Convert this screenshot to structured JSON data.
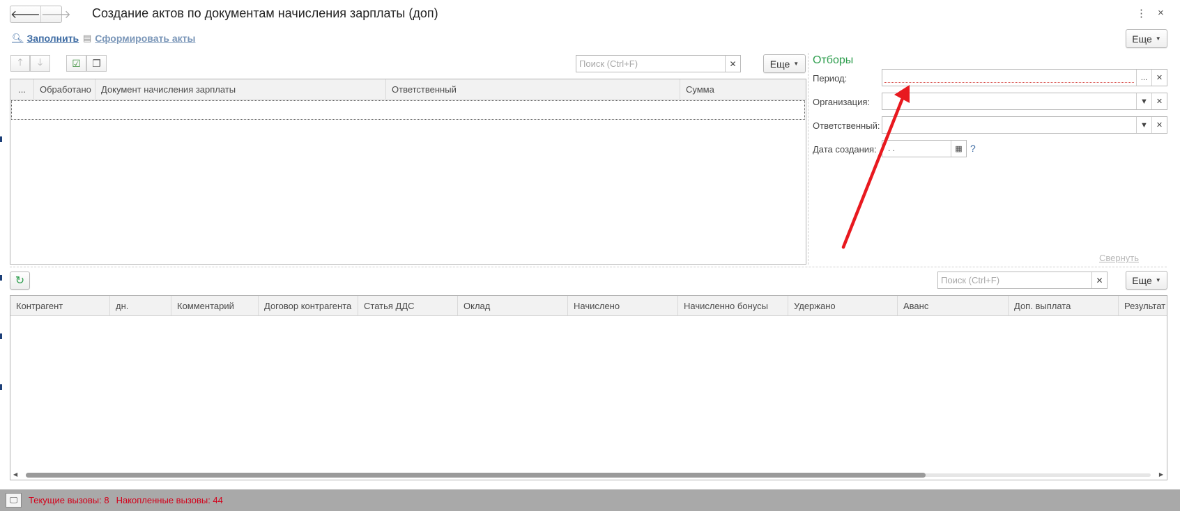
{
  "window": {
    "title": "Создание актов по документам начисления зарплаты (доп)",
    "more_icon": "kebab-menu-icon",
    "close_label": "×"
  },
  "nav": {
    "back": "🡐",
    "forward": "🡒"
  },
  "commands": {
    "fill_label": "Заполнить",
    "form_acts_label": "Сформировать акты",
    "more_label": "Еще"
  },
  "top_table": {
    "search_placeholder": "Поиск (Ctrl+F)",
    "more_label": "Еще",
    "columns": [
      "...",
      "Обработано",
      "Документ начисления зарплаты",
      "Ответственный",
      "Сумма"
    ],
    "rows": []
  },
  "filters": {
    "title": "Отборы",
    "period_label": "Период:",
    "organization_label": "Организация:",
    "responsible_label": "Ответственный:",
    "created_date_label": "Дата создания:",
    "created_date_value": " .  .",
    "help": "?",
    "collapse_label": "Свернуть"
  },
  "bottom_table": {
    "search_placeholder": "Поиск (Ctrl+F)",
    "more_label": "Еще",
    "columns": [
      "Контрагент",
      "дн.",
      "Комментарий",
      "Договор контрагента",
      "Статья ДДС",
      "Оклад",
      "Начислено",
      "Начисленно бонусы",
      "Удержано",
      "Аванс",
      "Доп. выплата",
      "Результат"
    ],
    "rows": [],
    "scroll_position": 0.0,
    "scroll_thumb_fraction": 0.8
  },
  "status": {
    "current_calls": "Текущие вызовы: 8",
    "accumulated_calls": "Накопленные вызовы: 44"
  },
  "colors": {
    "link": "#3d6ba3",
    "filters_title": "#2e9e4e",
    "status_text": "#d3001a",
    "annotation_arrow": "#e8191f",
    "statusbar_bg": "#a9a9a9"
  }
}
